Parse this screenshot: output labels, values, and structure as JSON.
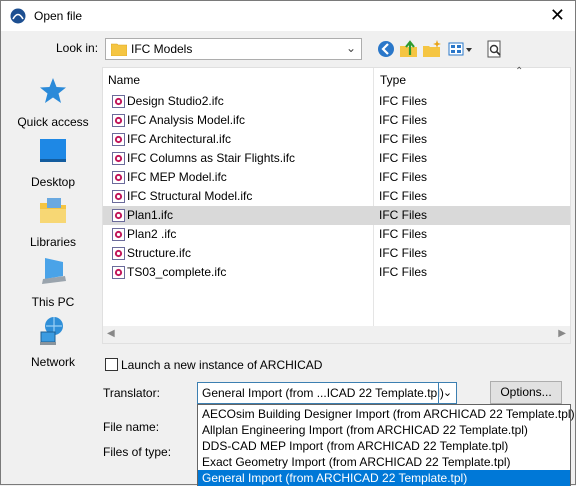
{
  "window": {
    "title": "Open file",
    "close_glyph": "✕"
  },
  "look_in": {
    "label": "Look in:",
    "value": "IFC Models"
  },
  "toolbar": {
    "icons": [
      "back-icon",
      "up-folder-icon",
      "new-folder-icon",
      "view-menu-icon",
      "preview-icon"
    ]
  },
  "places": [
    {
      "label": "Quick access",
      "icon": "star-icon"
    },
    {
      "label": "Desktop",
      "icon": "desktop-icon"
    },
    {
      "label": "Libraries",
      "icon": "libraries-icon"
    },
    {
      "label": "This PC",
      "icon": "computer-icon"
    },
    {
      "label": "Network",
      "icon": "network-icon"
    }
  ],
  "file_list": {
    "columns": {
      "name": "Name",
      "type": "Type"
    },
    "files": [
      {
        "name": "Design Studio2.ifc",
        "type": "IFC Files"
      },
      {
        "name": "IFC Analysis Model.ifc",
        "type": "IFC Files"
      },
      {
        "name": "IFC Architectural.ifc",
        "type": "IFC Files"
      },
      {
        "name": "IFC Columns as Stair Flights.ifc",
        "type": "IFC Files"
      },
      {
        "name": "IFC MEP Model.ifc",
        "type": "IFC Files"
      },
      {
        "name": "IFC Structural Model.ifc",
        "type": "IFC Files"
      },
      {
        "name": "Plan1.ifc",
        "type": "IFC Files",
        "selected": true
      },
      {
        "name": "Plan2 .ifc",
        "type": "IFC Files"
      },
      {
        "name": "Structure.ifc",
        "type": "IFC Files"
      },
      {
        "name": "TS03_complete.ifc",
        "type": "IFC Files"
      }
    ]
  },
  "launch_checkbox": {
    "label": "Launch a new instance of ARCHICAD",
    "checked": false
  },
  "translator": {
    "label": "Translator:",
    "value": "General Import (from ...ICAD 22 Template.tpl)",
    "options_button": "Options...",
    "dropdown_options": [
      "AECOsim Building Designer Import (from ARCHICAD 22 Template.tpl)",
      "Allplan Engineering Import (from ARCHICAD 22 Template.tpl)",
      "DDS-CAD MEP Import (from ARCHICAD 22 Template.tpl)",
      "Exact Geometry Import (from ARCHICAD 22 Template.tpl)",
      "General Import (from ARCHICAD 22 Template.tpl)"
    ],
    "selected_option": "General Import (from ARCHICAD 22 Template.tpl)"
  },
  "file_name": {
    "label": "File name:"
  },
  "files_of_type": {
    "label": "Files of type:"
  },
  "colors": {
    "accent": "#0078d7",
    "selected_row": "#d9d9d9"
  }
}
